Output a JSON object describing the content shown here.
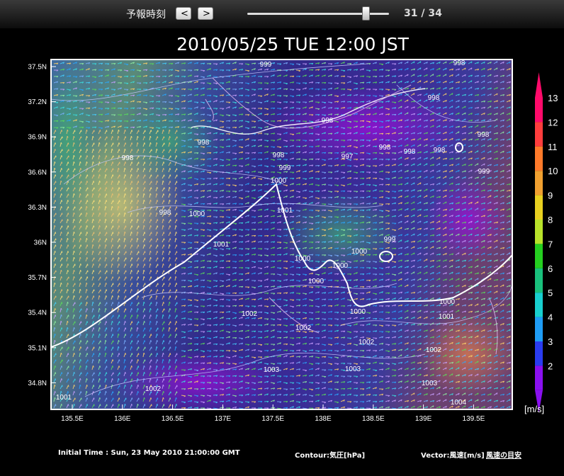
{
  "toolbar": {
    "forecast_time_label": "予報時刻",
    "prev_label": "<",
    "next_label": ">",
    "counter": "31 / 34",
    "frame_current": 31,
    "frame_total": 34
  },
  "title": "2010/05/25 TUE 12:00 JST",
  "axes": {
    "lat_labels": [
      "37.5N",
      "37.2N",
      "36.9N",
      "36.6N",
      "36.3N",
      "36N",
      "35.7N",
      "35.4N",
      "35.1N",
      "34.8N"
    ],
    "lon_labels": [
      "135.5E",
      "136E",
      "136.5E",
      "137E",
      "137.5E",
      "138E",
      "138.5E",
      "139E",
      "139.5E"
    ]
  },
  "colorbar": {
    "ticks": [
      "13",
      "12",
      "11",
      "10",
      "9",
      "8",
      "7",
      "6",
      "5",
      "4",
      "3",
      "2"
    ],
    "unit": "[m/s]",
    "colors": [
      "#ff0a6a",
      "#ff3d3d",
      "#ff7a2a",
      "#f0a030",
      "#e8d020",
      "#b8e22a",
      "#25cf20",
      "#19c07c",
      "#18cfcf",
      "#1e9cf5",
      "#2a3cf0",
      "#8a10f0"
    ]
  },
  "isobar_labels": [
    "999",
    "998",
    "998",
    "998",
    "998",
    "998",
    "998",
    "998",
    "998",
    "998",
    "998",
    "998",
    "997",
    "999",
    "999",
    "999",
    "1000",
    "1000",
    "1000",
    "1000",
    "1000",
    "1000",
    "1000",
    "1000",
    "1001",
    "1001",
    "1001",
    "1002",
    "1002",
    "1002",
    "1002",
    "1002",
    "1003",
    "1003",
    "1003",
    "1004",
    "1001"
  ],
  "footer": {
    "initial_time": "Initial Time : Sun, 23 May 2010 21:00:00 GMT",
    "contour": "Contour:気圧[hPa]",
    "vector": "Vector:風速[m/s]",
    "wind_guide": "風速の目安"
  }
}
